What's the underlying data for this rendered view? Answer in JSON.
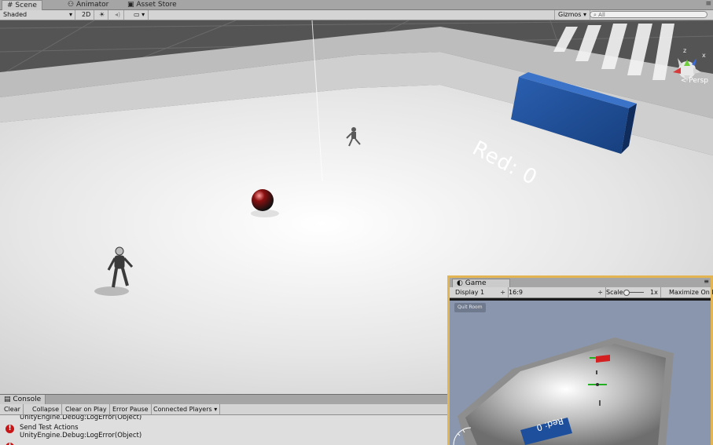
{
  "top_tabs": [
    {
      "icon": "scene-icon",
      "label": "Scene"
    },
    {
      "icon": "animator-icon",
      "label": "Animator"
    },
    {
      "icon": "asset-store-icon",
      "label": "Asset Store"
    }
  ],
  "scene_toolbar": {
    "shading_mode": "Shaded",
    "mode_2d": "2D",
    "gizmos": "Gizmos",
    "search_placeholder": "All"
  },
  "scene": {
    "wall_text": "Red: 0",
    "persp_label": "< Persp",
    "colors": {
      "floor": "#e8e8e8",
      "wall": "#c9c9c9",
      "backdrop": "#545454",
      "goal": "#1e4f9c",
      "ball": "#8a1010"
    }
  },
  "console": {
    "tab_label": "Console",
    "buttons": [
      "Clear",
      "Collapse",
      "Clear on Play",
      "Error Pause",
      "Connected Players"
    ],
    "log_top_line": "UnityEngine.Debug:LogError(Object)",
    "entries": [
      {
        "title": "Send Test Actions",
        "detail": "UnityEngine.Debug:LogError(Object)"
      }
    ]
  },
  "game": {
    "tab_label": "Game",
    "display": "Display 1",
    "aspect": "16:9",
    "scale_label": "Scale",
    "scale_value": "1x",
    "maximize": "Maximize On P",
    "overlay_button": "Quit Room",
    "wall_text": "Red: 0",
    "colors": {
      "accent_border": "#e2b452",
      "red_goal": "#d42020",
      "blue_goal": "#1e4f9c",
      "bar": "#22b022"
    }
  }
}
